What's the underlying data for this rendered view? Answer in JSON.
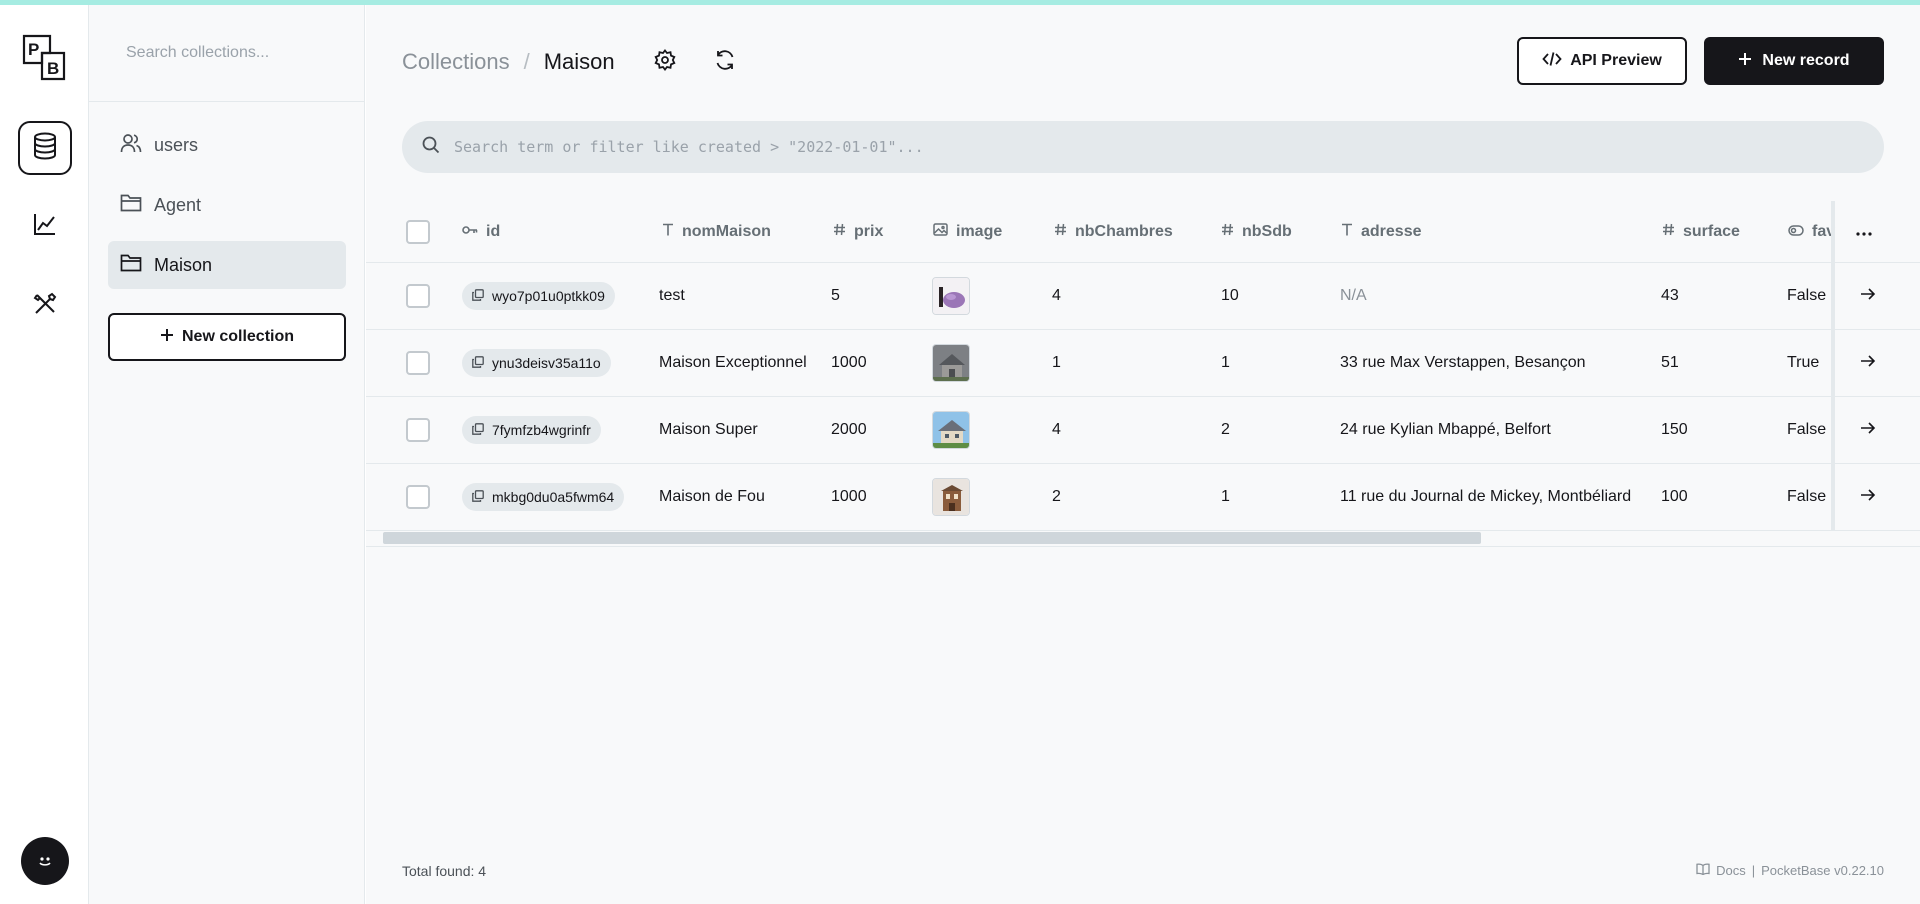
{
  "app": {
    "logo_text": "PB"
  },
  "rail": {
    "items": [
      {
        "icon": "database-icon",
        "active": true
      },
      {
        "icon": "chart-line-icon",
        "active": false
      },
      {
        "icon": "tools-icon",
        "active": false
      }
    ]
  },
  "sidebar": {
    "search_placeholder": "Search collections...",
    "items": [
      {
        "label": "users",
        "icon": "users-icon",
        "active": false
      },
      {
        "label": "Agent",
        "icon": "folder-icon",
        "active": false
      },
      {
        "label": "Maison",
        "icon": "folder-icon",
        "active": true
      }
    ],
    "new_collection_label": "New collection"
  },
  "header": {
    "breadcrumb_root": "Collections",
    "breadcrumb_sep": "/",
    "breadcrumb_current": "Maison",
    "api_preview_label": "API Preview",
    "new_record_label": "New record"
  },
  "search": {
    "placeholder": "Search term or filter like created > \"2022-01-01\"..."
  },
  "table": {
    "columns": [
      {
        "key": "id",
        "label": "id",
        "icon": "key-icon"
      },
      {
        "key": "nomMaison",
        "label": "nomMaison",
        "icon": "text-icon"
      },
      {
        "key": "prix",
        "label": "prix",
        "icon": "hash-icon"
      },
      {
        "key": "image",
        "label": "image",
        "icon": "image-icon"
      },
      {
        "key": "nbChambres",
        "label": "nbChambres",
        "icon": "hash-icon"
      },
      {
        "key": "nbSdb",
        "label": "nbSdb",
        "icon": "hash-icon"
      },
      {
        "key": "adresse",
        "label": "adresse",
        "icon": "text-icon"
      },
      {
        "key": "surface",
        "label": "surface",
        "icon": "hash-icon"
      },
      {
        "key": "favori",
        "label": "fav",
        "icon": "toggle-icon"
      }
    ],
    "rows": [
      {
        "id": "wyo7p01u0ptkk09",
        "nomMaison": "test",
        "prix": "5",
        "image": "purple-blob",
        "nbChambres": "4",
        "nbSdb": "10",
        "adresse": "N/A",
        "adresse_empty": true,
        "surface": "43",
        "favori": "False"
      },
      {
        "id": "ynu3deisv35a11o",
        "nomMaison": "Maison Exceptionnel",
        "prix": "1000",
        "image": "grey-house",
        "nbChambres": "1",
        "nbSdb": "1",
        "adresse": "33 rue Max Verstappen, Besançon",
        "adresse_empty": false,
        "surface": "51",
        "favori": "True"
      },
      {
        "id": "7fymfzb4wgrinfr",
        "nomMaison": "Maison Super",
        "prix": "2000",
        "image": "blue-house",
        "nbChambres": "4",
        "nbSdb": "2",
        "adresse": "24 rue Kylian Mbappé, Belfort",
        "adresse_empty": false,
        "surface": "150",
        "favori": "False"
      },
      {
        "id": "mkbg0du0a5fwm64",
        "nomMaison": "Maison de Fou",
        "prix": "1000",
        "image": "brown-house",
        "nbChambres": "2",
        "nbSdb": "1",
        "adresse": "11 rue du Journal de Mickey, Montbéliard",
        "adresse_empty": false,
        "surface": "100",
        "favori": "False"
      }
    ]
  },
  "footer": {
    "total_label": "Total found:",
    "total_count": "4",
    "docs_label": "Docs",
    "separator": "|",
    "version_label": "PocketBase v0.22.10"
  }
}
